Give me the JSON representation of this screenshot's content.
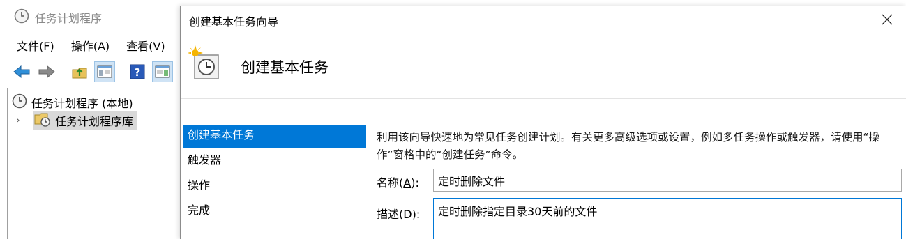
{
  "main_window": {
    "title": "任务计划程序",
    "menu": [
      {
        "label": "文件(F)"
      },
      {
        "label": "操作(A)"
      },
      {
        "label": "查看(V)"
      }
    ],
    "toolbar_icons": [
      "back-arrow-icon",
      "forward-arrow-icon",
      "folder-up-icon",
      "show-hide-pane-icon",
      "help-icon",
      "action-pane-icon"
    ],
    "tree": {
      "root_label": "任务计划程序 (本地)",
      "library_label": "任务计划程序库"
    }
  },
  "wizard": {
    "window_title": "创建基本任务向导",
    "header_title": "创建基本任务",
    "steps": [
      {
        "label": "创建基本任务",
        "active": true
      },
      {
        "label": "触发器",
        "active": false
      },
      {
        "label": "操作",
        "active": false
      },
      {
        "label": "完成",
        "active": false
      }
    ],
    "description": "利用该向导快速地为常见任务创建计划。有关更多高级选项或设置，例如多任务操作或触发器，请使用“操作”窗格中的“创建任务”命令。",
    "name_field": {
      "label_prefix": "名称(",
      "label_key": "A",
      "label_suffix": "):",
      "value": "定时删除文件"
    },
    "desc_field": {
      "label_prefix": "描述(",
      "label_key": "D",
      "label_suffix": "):",
      "value": "定时删除指定目录30天前的文件"
    }
  },
  "colors": {
    "accent": "#0078d7",
    "selection_gray": "#d9d9d9"
  }
}
